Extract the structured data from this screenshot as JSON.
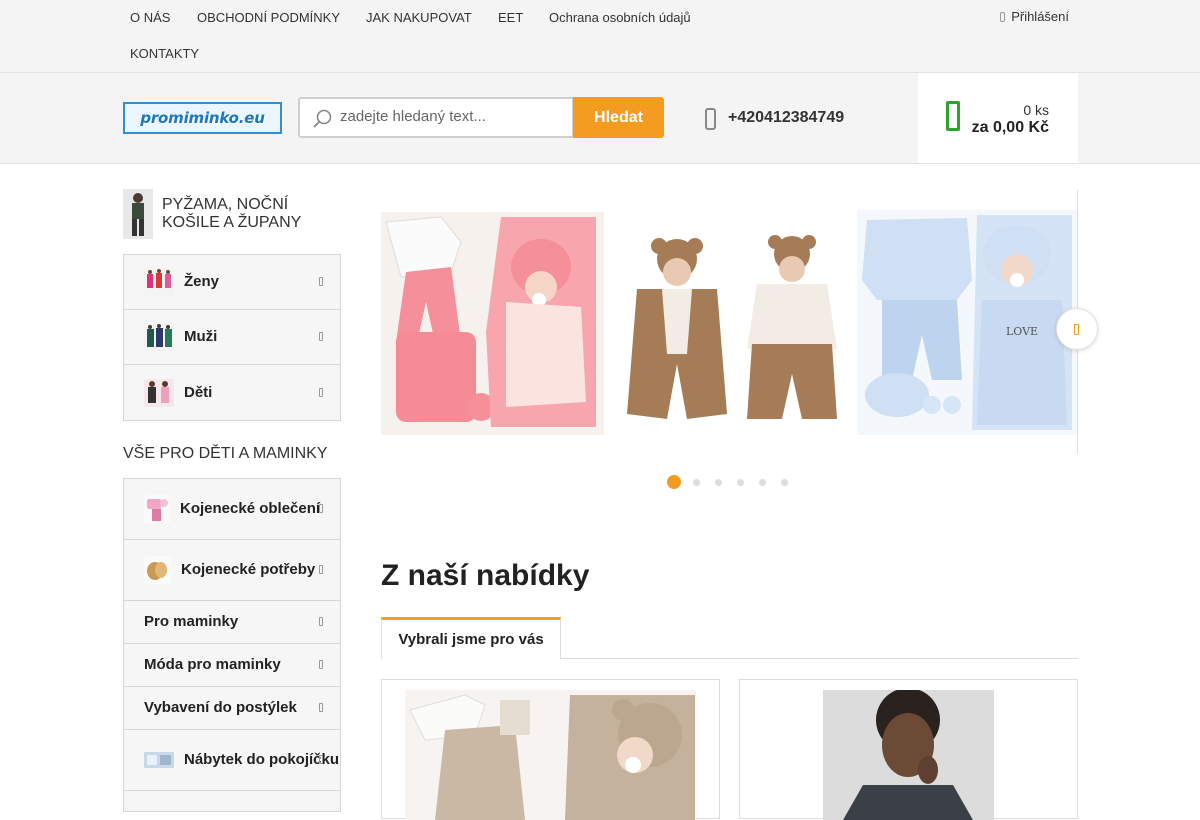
{
  "topnav": {
    "items": [
      "O NÁS",
      "OBCHODNÍ PODMÍNKY",
      "JAK NAKUPOVAT",
      "EET",
      "Ochrana osobních údajů",
      "KONTAKTY"
    ],
    "login_label": "Přihlášení"
  },
  "header": {
    "logo_text": "promiminko.eu",
    "search_placeholder": "zadejte hledaný text...",
    "search_button": "Hledat",
    "phone": "+420412384749",
    "cart_qty": "0 ks",
    "cart_total": "za 0,00 Kč"
  },
  "sidebar": {
    "section1_title": "PYŽAMA, NOČNÍ KOŠILE A ŽUPANY",
    "section1_items": [
      {
        "label": "Ženy"
      },
      {
        "label": "Muži"
      },
      {
        "label": "Děti"
      }
    ],
    "section2_title": "VŠE PRO DĚTI A MAMINKY",
    "section2_items": [
      {
        "label": "Kojenecké oblečení"
      },
      {
        "label": "Kojenecké potřeby"
      },
      {
        "label": "Pro maminky"
      },
      {
        "label": "Móda pro maminky"
      },
      {
        "label": "Vybavení do postýlek"
      },
      {
        "label": "Nábytek do pokojíčku"
      }
    ]
  },
  "slider": {
    "slide_count": 6,
    "active_index": 0
  },
  "offer": {
    "title": "Z naší nabídky",
    "tab_label": "Vybrali jsme pro vás"
  },
  "colors": {
    "accent": "#f39c1f",
    "cart_green": "#2ea42e",
    "logo_blue": "#1b78bf"
  }
}
